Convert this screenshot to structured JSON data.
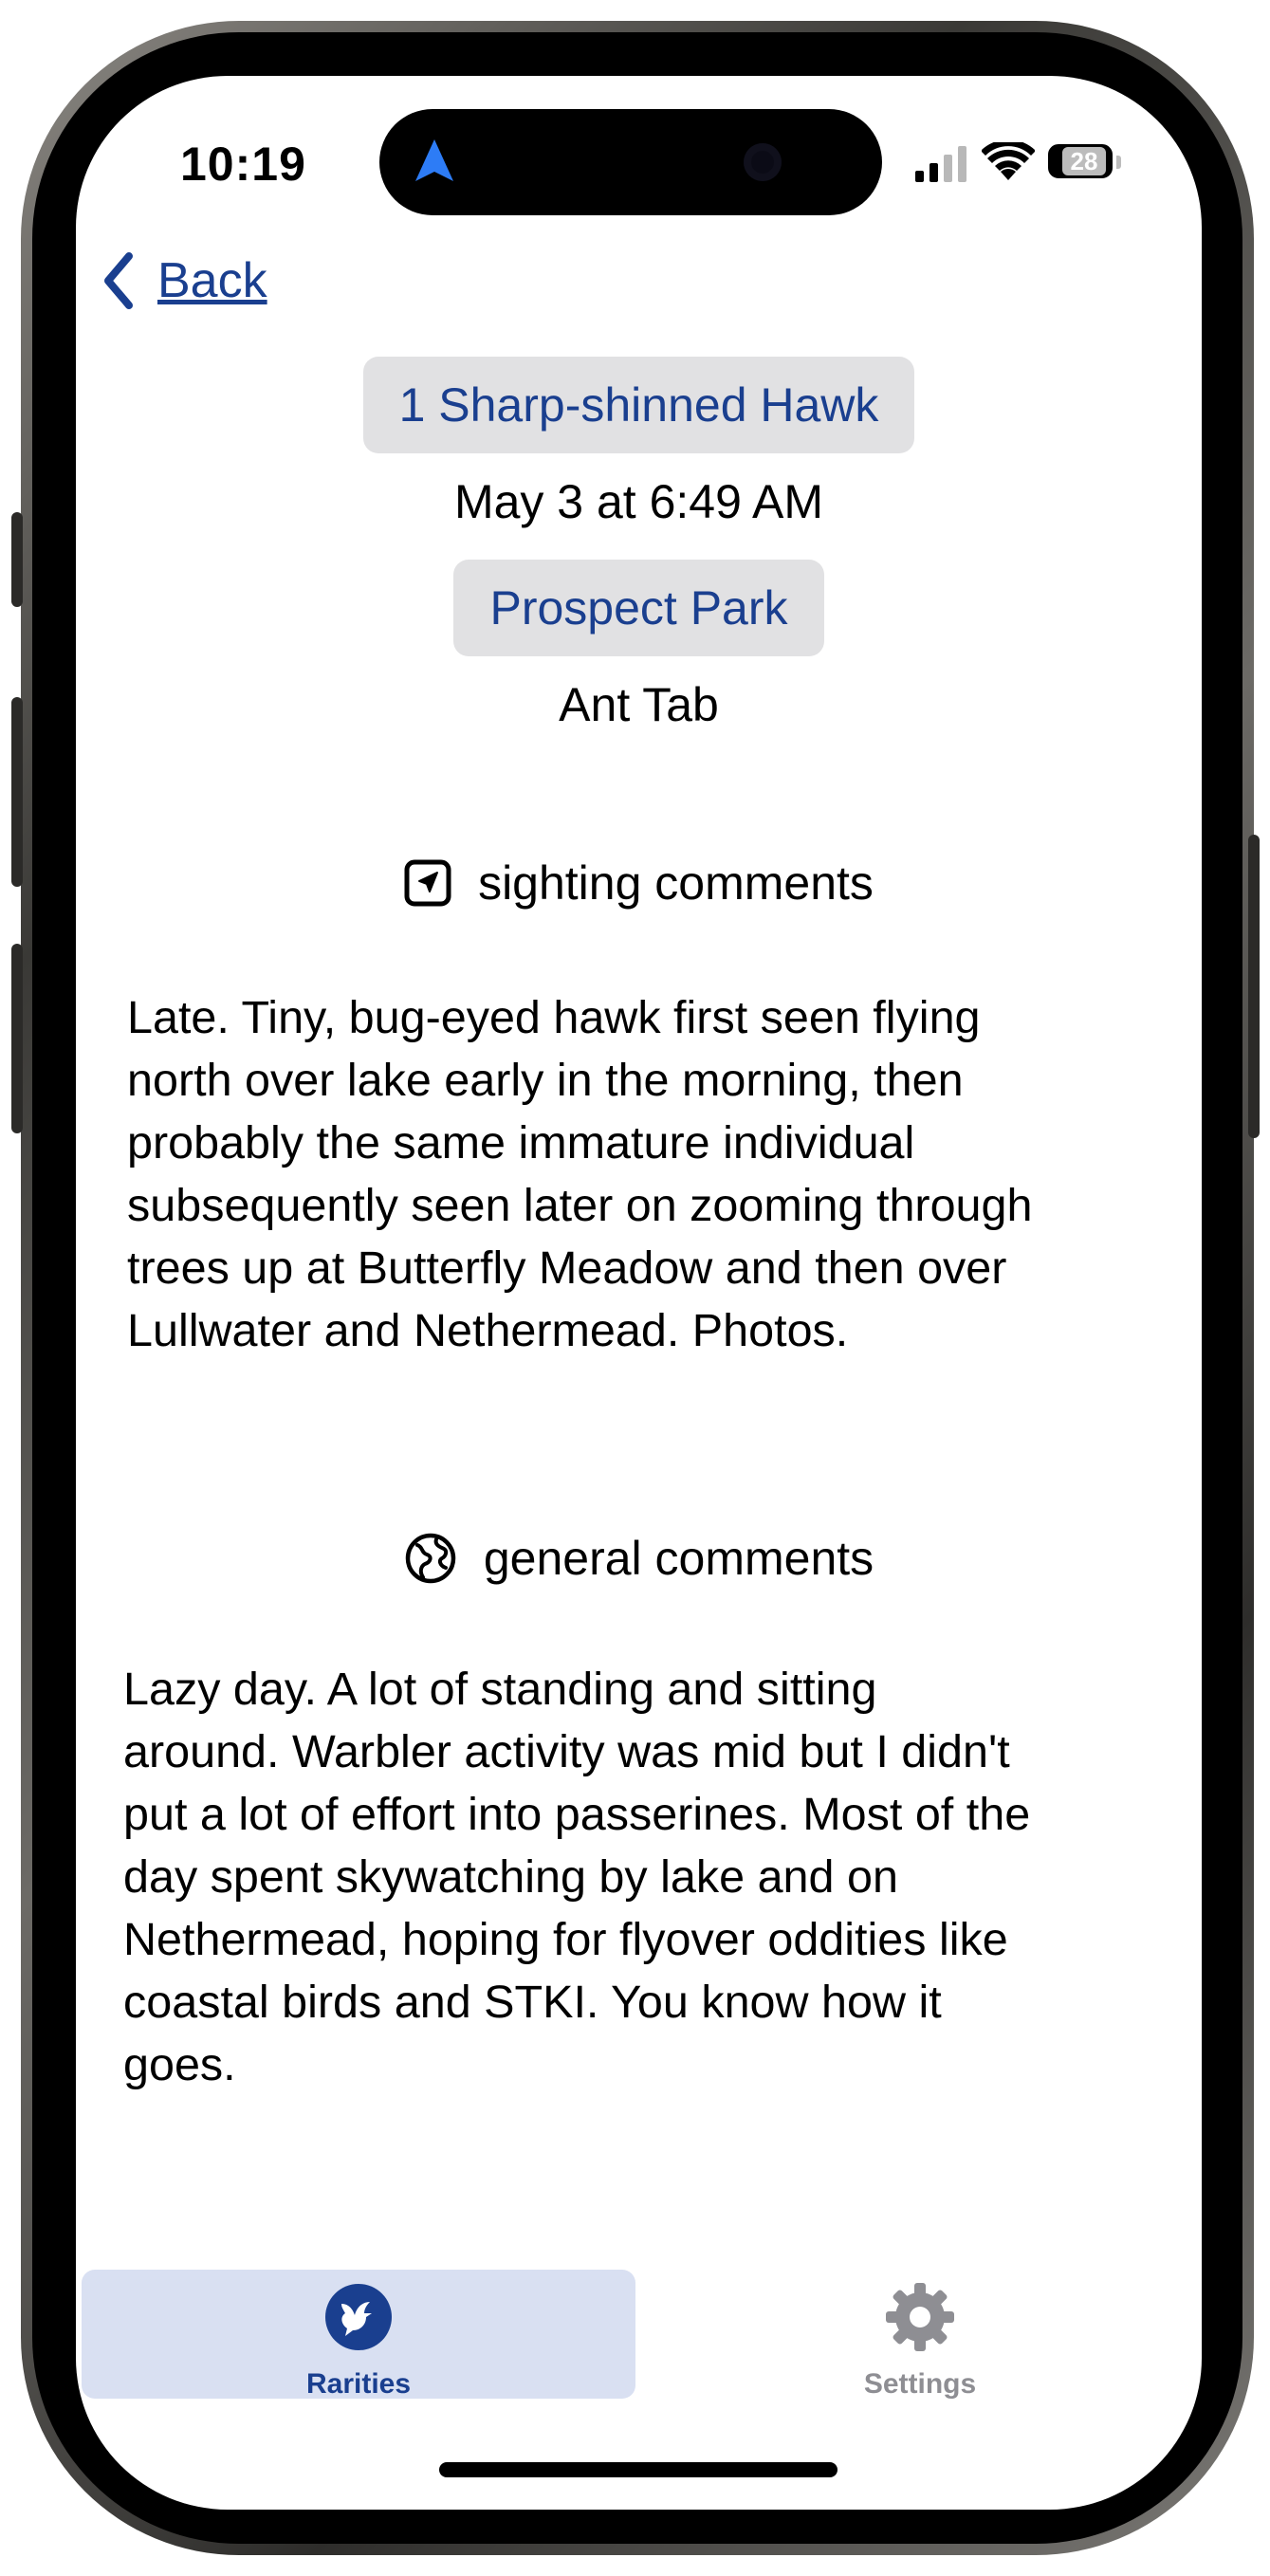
{
  "status_bar": {
    "time": "10:19",
    "battery": "28"
  },
  "nav": {
    "back_label": "Back"
  },
  "sighting": {
    "species": "1 Sharp-shinned Hawk",
    "datetime": "May 3 at 6:49 AM",
    "location": "Prospect Park",
    "observer": "Ant Tab"
  },
  "sighting_comments": {
    "heading": "sighting comments",
    "icon": "location-arrow-icon",
    "lines": [
      "Late. Tiny, bug-eyed hawk first seen flying",
      "north over lake early in the morning, then",
      "probably the same immature individual",
      "subsequently seen later on zooming through",
      "trees up at Butterfly Meadow and then over",
      "Lullwater and Nethermead. Photos."
    ]
  },
  "general_comments": {
    "heading": "general comments",
    "icon": "globe-icon",
    "lines": [
      "Lazy day. A lot of standing and sitting",
      "around. Warbler activity was mid but I didn't",
      "put a lot of effort into passerines. Most of the",
      "day spent skywatching by lake and on",
      "Nethermead, hoping for flyover oddities like",
      "coastal birds and STKI. You know how it",
      "goes."
    ]
  },
  "tab_bar": {
    "tabs": [
      {
        "label": "Rarities",
        "icon": "bird-icon",
        "selected": true
      },
      {
        "label": "Settings",
        "icon": "gear-icon",
        "selected": false
      }
    ]
  },
  "colors": {
    "accent": "#1a3f8f",
    "pill_bg": "#e1e1e3",
    "tab_selected_bg": "#d9e0f2",
    "tab_inactive": "#8e8e93"
  }
}
